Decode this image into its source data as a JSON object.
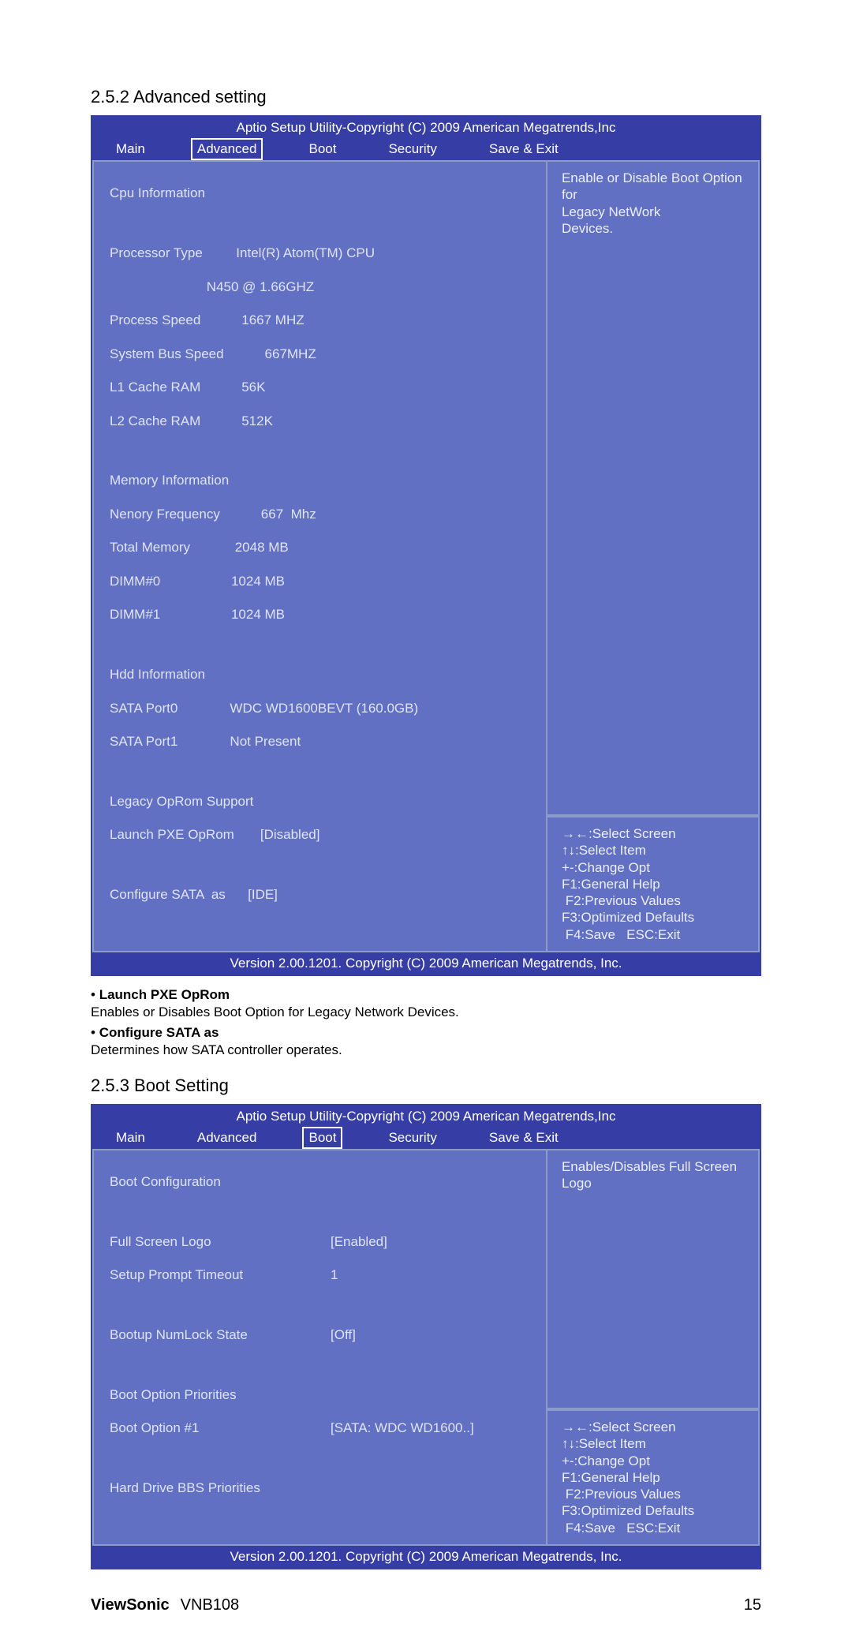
{
  "doc": {
    "brand": "ViewSonic",
    "model": "VNB108",
    "page_no": "15"
  },
  "sec_adv": {
    "heading": "2.5.2 Advanced setting",
    "title": "Aptio Setup Utility-Copyright (C) 2009 American Megatrends,Inc",
    "tabs": {
      "main": "Main",
      "advanced": "Advanced",
      "boot": "Boot",
      "security": "Security",
      "saveexit": "Save & Exit"
    },
    "left": {
      "l01": "Cpu Information",
      "l02": "Processor Type         Intel(R) Atom(TM) CPU",
      "l03": "                          N450 @ 1.66GHZ",
      "l04": "Process Speed           1667 MHZ",
      "l05": "System Bus Speed           667MHZ",
      "l06": "L1 Cache RAM           56K",
      "l07": "L2 Cache RAM           512K",
      "l08": "Memory Information",
      "l09": "Nenory Frequency           667  Mhz",
      "l10": "Total Memory            2048 MB",
      "l11": "DIMM#0                   1024 MB",
      "l12": "DIMM#1                   1024 MB",
      "l13": "Hdd Information",
      "l14": "SATA Port0              WDC WD1600BEVT (160.0GB)",
      "l15": "SATA Port1              Not Present",
      "l16": "Legacy OpRom Support",
      "l17k": "Launch PXE OpRom",
      "l17v": "[Disabled]",
      "l18k": "Configure SATA  as",
      "l18v": "[IDE]"
    },
    "help_top": {
      "r1": "Enable or Disable Boot Option for",
      "r2": "Legacy NetWork",
      "r3": "Devices."
    },
    "help_bot": {
      "b1": "→←:Select Screen",
      "b2": "↑↓:Select Item",
      "b3": "+-:Change Opt",
      "b4": "F1:General Help",
      "b5": " F2:Previous Values",
      "b6": "F3:Optimized Defaults",
      "b7": " F4:Save   ESC:Exit"
    },
    "version": "Version 2.00.1201. Copyright (C)  2009 American Megatrends, Inc."
  },
  "adv_notes": {
    "n1_title": "Launch PXE OpRom",
    "n1_body": "Enables or Disables Boot Option for Legacy Network Devices.",
    "n2_title": "Configure SATA as",
    "n2_body": "Determines how SATA controller operates."
  },
  "sec_boot": {
    "heading": "2.5.3 Boot Setting",
    "title": "Aptio Setup Utility-Copyright (C) 2009 American Megatrends,Inc",
    "tabs": {
      "main": "Main",
      "advanced": "Advanced",
      "boot": "Boot",
      "security": "Security",
      "saveexit": "Save & Exit"
    },
    "left": {
      "l01": "Boot Configuration",
      "l02k": "Full Screen Logo",
      "l02v": "[Enabled]",
      "l03k": "Setup Prompt Timeout",
      "l03v": "1",
      "l04k": "Bootup NumLock State",
      "l04v": "[Off]",
      "l05": "Boot Option Priorities",
      "l06k": "Boot Option #1",
      "l06v": "[SATA: WDC WD1600..]",
      "l07": "Hard Drive BBS Priorities"
    },
    "help_top": {
      "r1": "Enables/Disables  Full  Screen",
      "r2": "Logo"
    },
    "help_bot": {
      "b1": "→←:Select Screen",
      "b2": "↑↓:Select Item",
      "b3": "+-:Change Opt",
      "b4": "F1:General Help",
      "b5": " F2:Previous Values",
      "b6": "F3:Optimized Defaults",
      "b7": " F4:Save   ESC:Exit"
    },
    "version": "Version 2.00.1201. Copyright (C)  2009 American Megatrends, Inc."
  }
}
